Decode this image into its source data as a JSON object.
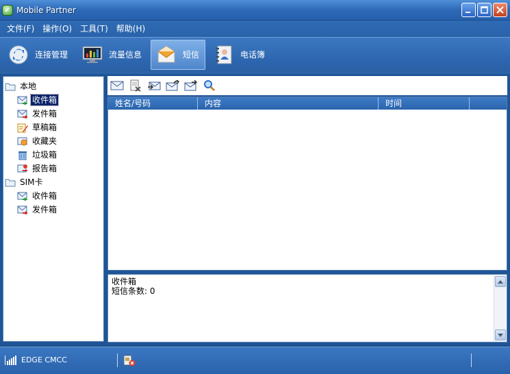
{
  "window": {
    "title": "Mobile Partner",
    "icon": "app-logo-icon"
  },
  "menu": [
    "文件(F)",
    "操作(O)",
    "工具(T)",
    "帮助(H)"
  ],
  "mainbar": [
    {
      "label": "连接管理",
      "icon": "connect-icon"
    },
    {
      "label": "流量信息",
      "icon": "traffic-monitor-icon"
    },
    {
      "label": "短信",
      "icon": "sms-envelope-icon",
      "active": true
    },
    {
      "label": "电话簿",
      "icon": "phonebook-icon"
    }
  ],
  "tree": {
    "local": {
      "label": "本地",
      "items": [
        "收件箱",
        "发件箱",
        "草稿箱",
        "收藏夹",
        "垃圾箱",
        "报告箱"
      ]
    },
    "sim": {
      "label": "SIM卡",
      "items": [
        "收件箱",
        "发件箱"
      ]
    },
    "selected": "本地/收件箱"
  },
  "list_toolbar": [
    "new-message-icon",
    "delete-message-icon",
    "reply-icon",
    "forward-icon",
    "resend-icon",
    "search-icon"
  ],
  "list": {
    "columns": [
      "姓名/号码",
      "内容",
      "时间",
      ""
    ],
    "rows": []
  },
  "detail": {
    "line1": "收件箱",
    "line2": "短信条数: 0"
  },
  "status": {
    "network": "EDGE  CMCC",
    "signal_bars": 5
  },
  "colors": {
    "titlebar": "#2d69b7",
    "selection": "#0a246a",
    "accent": "#3b77c2"
  }
}
